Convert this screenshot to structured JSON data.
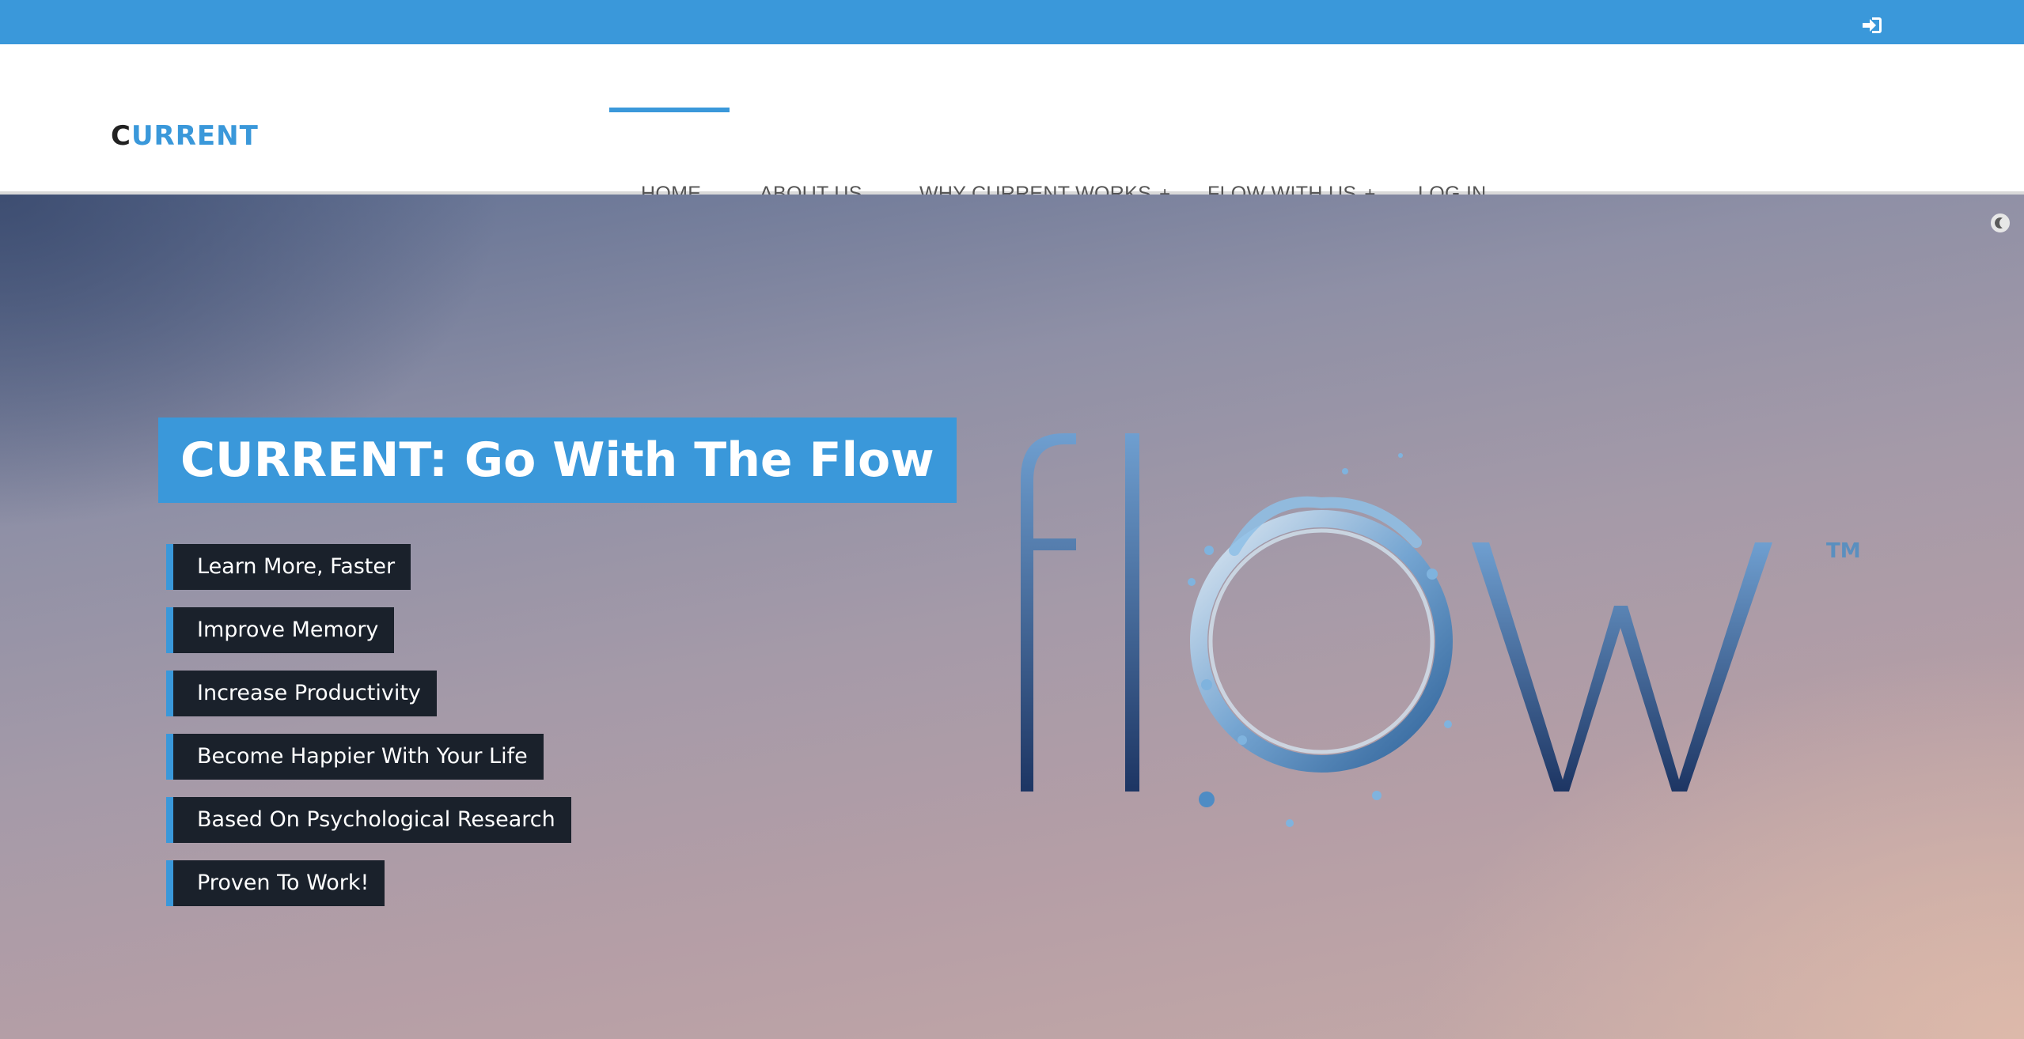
{
  "topbar": {
    "login_icon": "sign-in-icon",
    "color": "#3a98da"
  },
  "header": {
    "logo_first": "C",
    "logo_rest": "URRENT",
    "nav": [
      {
        "label": "HOME",
        "active": true
      },
      {
        "label": "ABOUT US"
      },
      {
        "label": "WHY CURRENT WORKS",
        "plus": "+"
      },
      {
        "label": "FLOW WITH US",
        "plus": "+"
      },
      {
        "label": "LOG IN"
      }
    ]
  },
  "hero": {
    "headline": "CURRENT: Go With The Flow",
    "features": [
      "Learn More, Faster",
      "Improve Memory",
      "Increase Productivity",
      "Become Happier With Your Life",
      "Based On Psychological Research",
      "Proven To Work!"
    ],
    "logo_word": "flow",
    "trademark": "TM"
  },
  "colors": {
    "accent": "#3a98da",
    "feature_bg": "#1a212b",
    "logo_dark": "#1d3563"
  }
}
